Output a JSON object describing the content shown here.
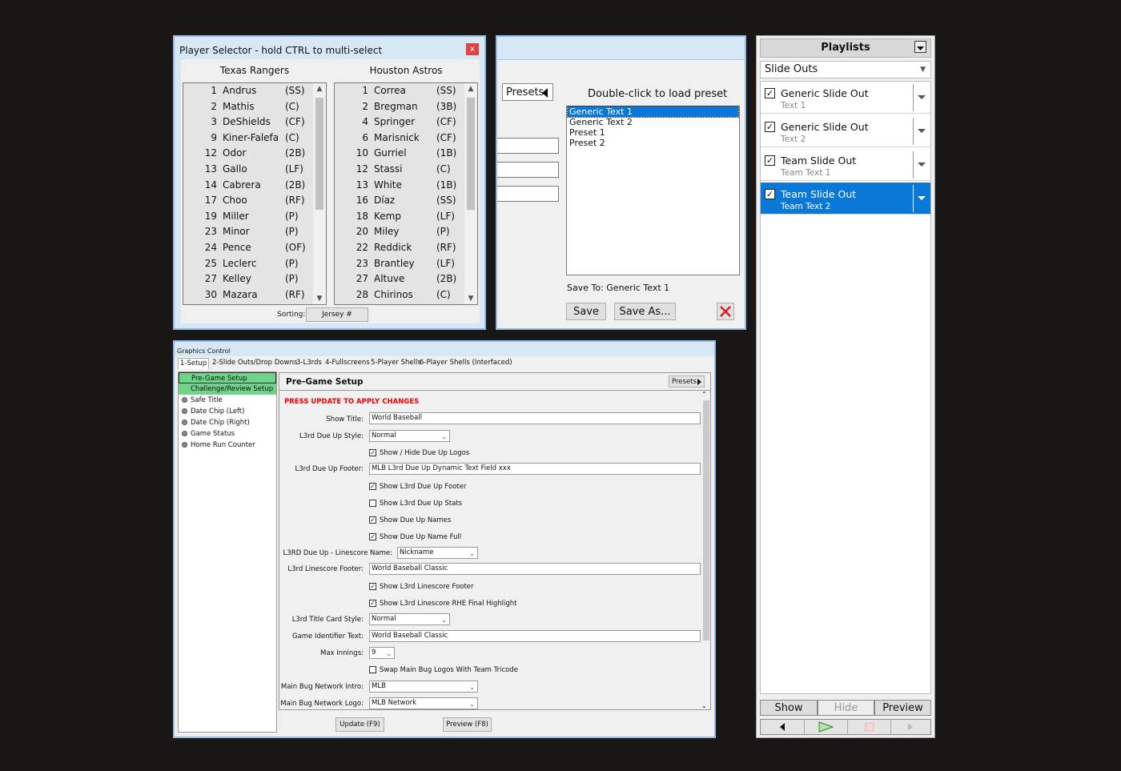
{
  "player_selector": {
    "title": "Player Selector - hold CTRL to multi-select",
    "close": "x",
    "sorting_label": "Sorting:",
    "sorting_value": "Jersey #",
    "teams": [
      {
        "name": "Texas Rangers",
        "players": [
          {
            "num": "1",
            "name": "Andrus",
            "pos": "(SS)"
          },
          {
            "num": "2",
            "name": "Mathis",
            "pos": "(C)"
          },
          {
            "num": "3",
            "name": "DeShields",
            "pos": "(CF)"
          },
          {
            "num": "9",
            "name": "Kiner-Falefa",
            "pos": "(C)"
          },
          {
            "num": "12",
            "name": "Odor",
            "pos": "(2B)"
          },
          {
            "num": "13",
            "name": "Gallo",
            "pos": "(LF)"
          },
          {
            "num": "14",
            "name": "Cabrera",
            "pos": "(2B)"
          },
          {
            "num": "17",
            "name": "Choo",
            "pos": "(RF)"
          },
          {
            "num": "19",
            "name": "Miller",
            "pos": "(P)"
          },
          {
            "num": "23",
            "name": "Minor",
            "pos": "(P)"
          },
          {
            "num": "24",
            "name": "Pence",
            "pos": "(OF)"
          },
          {
            "num": "25",
            "name": "Leclerc",
            "pos": "(P)"
          },
          {
            "num": "27",
            "name": "Kelley",
            "pos": "(P)"
          },
          {
            "num": "30",
            "name": "Mazara",
            "pos": "(RF)"
          }
        ]
      },
      {
        "name": "Houston Astros",
        "players": [
          {
            "num": "1",
            "name": "Correa",
            "pos": "(SS)"
          },
          {
            "num": "2",
            "name": "Bregman",
            "pos": "(3B)"
          },
          {
            "num": "4",
            "name": "Springer",
            "pos": "(CF)"
          },
          {
            "num": "6",
            "name": "Marisnick",
            "pos": "(CF)"
          },
          {
            "num": "10",
            "name": "Gurriel",
            "pos": "(1B)"
          },
          {
            "num": "12",
            "name": "Stassi",
            "pos": "(C)"
          },
          {
            "num": "13",
            "name": "White",
            "pos": "(1B)"
          },
          {
            "num": "16",
            "name": "Díaz",
            "pos": "(SS)"
          },
          {
            "num": "18",
            "name": "Kemp",
            "pos": "(LF)"
          },
          {
            "num": "20",
            "name": "Miley",
            "pos": "(P)"
          },
          {
            "num": "22",
            "name": "Reddick",
            "pos": "(RF)"
          },
          {
            "num": "23",
            "name": "Brantley",
            "pos": "(LF)"
          },
          {
            "num": "27",
            "name": "Altuve",
            "pos": "(2B)"
          },
          {
            "num": "28",
            "name": "Chirinos",
            "pos": "(C)"
          }
        ]
      }
    ]
  },
  "presets": {
    "button": "Presets",
    "instruction": "Double-click to load preset",
    "items": [
      "Generic Text 1",
      "Generic Text 2",
      "Preset 1",
      "Preset 2"
    ],
    "selected_index": 0,
    "save_to": "Save To: Generic Text 1",
    "save": "Save",
    "save_as": "Save As..."
  },
  "playlists": {
    "title": "Playlists",
    "combo": "Slide Outs",
    "items": [
      {
        "title": "Generic Slide Out",
        "sub": "Text 1",
        "checked": true,
        "selected": false
      },
      {
        "title": "Generic Slide Out",
        "sub": "Text 2",
        "checked": true,
        "selected": false
      },
      {
        "title": "Team Slide Out",
        "sub": "Team Text 1",
        "checked": true,
        "selected": false
      },
      {
        "title": "Team Slide Out",
        "sub": "Team Text 2",
        "checked": true,
        "selected": true
      }
    ],
    "show": "Show",
    "hide": "Hide",
    "preview": "Preview"
  },
  "graphics_control": {
    "title": "Graphics Control",
    "tabs": [
      "1-Setup",
      "2-Slide Outs/Drop Downs",
      "3-L3rds",
      "4-Fullscreens",
      "5-Player Shells",
      "6-Player Shells (Interfaced)"
    ],
    "left_items": [
      {
        "label": "Pre-Game Setup",
        "green": true
      },
      {
        "label": "Challenge/Review Setup",
        "green": true
      },
      {
        "label": "Safe Title",
        "green": false
      },
      {
        "label": "Date Chip (Left)",
        "green": false
      },
      {
        "label": "Date Chip (Right)",
        "green": false
      },
      {
        "label": "Game Status",
        "green": false
      },
      {
        "label": "Home Run Counter",
        "green": false
      }
    ],
    "panel_title": "Pre-Game Setup",
    "presets": "Presets",
    "warning": "PRESS UPDATE TO APPLY CHANGES",
    "fields": {
      "show_title_label": "Show Title:",
      "show_title_value": "World Baseball",
      "l3rd_style_label": "L3rd Due Up Style:",
      "l3rd_style_value": "Normal",
      "show_hide_logos": "Show / Hide Due Up Logos",
      "l3rd_footer_label": "L3rd Due Up Footer:",
      "l3rd_footer_value": "MLB L3rd Due Up Dynamic Text Field xxx",
      "show_l3rd_footer": "Show L3rd Due Up Footer",
      "show_l3rd_stats": "Show L3rd Due Up Stats",
      "show_due_names": "Show Due Up Names",
      "show_due_name_full": "Show Due Up Name Full",
      "linescore_name_label": "L3RD Due Up - Linescore Name:",
      "linescore_name_value": "Nickname",
      "linescore_footer_label": "L3rd Linescore Footer:",
      "linescore_footer_value": "World Baseball Classic",
      "show_linescore_footer": "Show L3rd Linescore Footer",
      "show_rhe": "Show L3rd Linescore RHE Final Highlight",
      "title_card_label": "L3rd Title Card Style:",
      "title_card_value": "Normal",
      "game_id_label": "Game Identifier Text:",
      "game_id_value": "World Baseball Classic",
      "max_innings_label": "Max Innings:",
      "max_innings_value": "9",
      "swap_logos": "Swap Main Bug Logos With Team Tricode",
      "network_intro_label": "Main Bug Network Intro:",
      "network_intro_value": "MLB",
      "network_logo_label": "Main Bug Network Logo:",
      "network_logo_value": "MLB Network"
    },
    "update": "Update (F9)",
    "preview": "Preview (F8)"
  }
}
